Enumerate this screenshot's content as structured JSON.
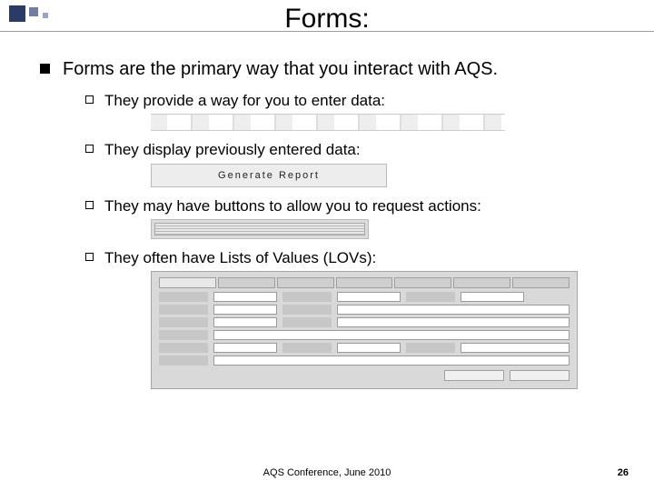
{
  "title": "Forms:",
  "bullet1": "Forms are the primary way that you interact with AQS.",
  "subs": {
    "a": "They provide a way for you to enter data:",
    "b": "They display previously entered data:",
    "c": "They may have buttons to allow you to request actions:",
    "d": "They often have Lists of Values (LOVs):"
  },
  "generate_btn_label": "Generate Report",
  "footer": "AQS Conference, June 2010",
  "page_number": "26"
}
